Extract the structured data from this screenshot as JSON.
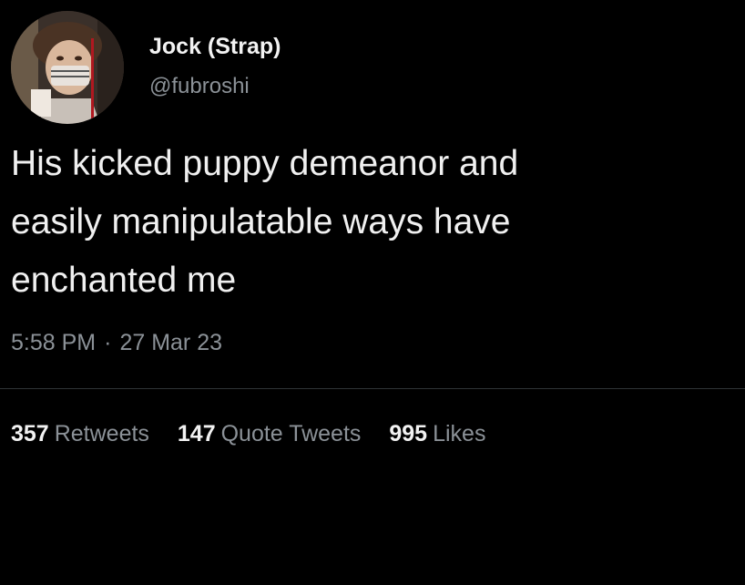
{
  "author": {
    "display_name": "Jock (Strap)",
    "handle": "@fubroshi",
    "avatar_icon": "profile-avatar"
  },
  "tweet": {
    "lines": [
      "His kicked puppy demeanor and",
      "easily manipulatable ways have",
      "enchanted me"
    ],
    "time": "5:58 PM",
    "separator": "·",
    "date": "27 Mar 23"
  },
  "stats": {
    "retweets_count": "357",
    "retweets_label": "Retweets",
    "quotes_count": "147",
    "quotes_label": "Quote Tweets",
    "likes_count": "995",
    "likes_label": "Likes"
  },
  "colors": {
    "background": "#000000",
    "primary_text": "#e7e9ea",
    "secondary_text": "#8b9197",
    "divider": "#2f3336"
  }
}
